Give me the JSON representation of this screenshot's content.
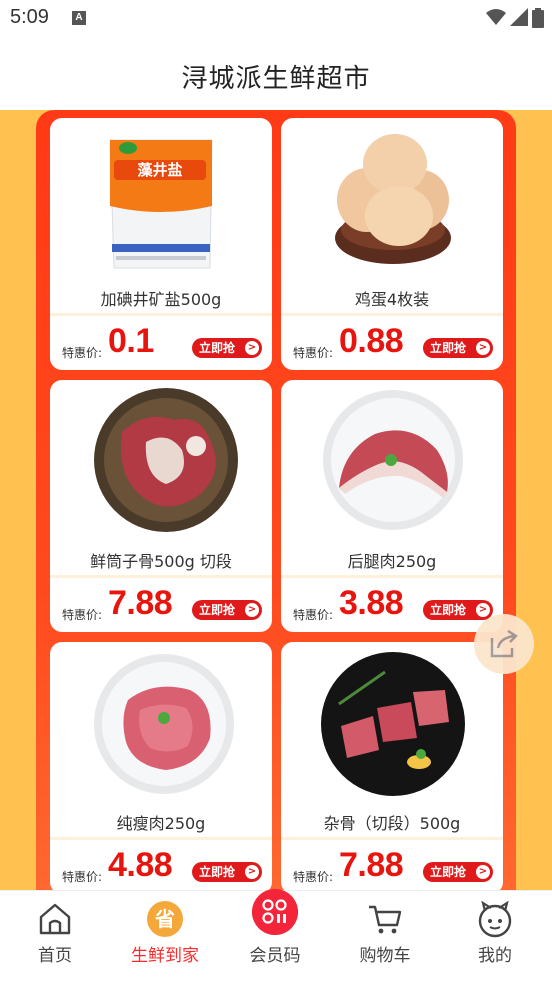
{
  "status_bar": {
    "time": "5:09",
    "notification_icon": "A"
  },
  "header": {
    "title": "浔城派生鲜超市"
  },
  "colors": {
    "accent": "#e8150e",
    "panel": "#ff3a16",
    "background": "#ffc14f",
    "active_tab": "#ff2a2a"
  },
  "products": [
    {
      "name": "加碘井矿盐500g",
      "price_label": "特惠价:",
      "price": "0.1",
      "button": "立即抢",
      "icon": "salt-bag-image",
      "package_text": "藻井盐"
    },
    {
      "name": "鸡蛋4枚装",
      "price_label": "特惠价:",
      "price": "0.88",
      "button": "立即抢",
      "icon": "eggs-image"
    },
    {
      "name": "鲜筒子骨500g 切段",
      "price_label": "特惠价:",
      "price": "7.88",
      "button": "立即抢",
      "icon": "pork-bone-image"
    },
    {
      "name": "后腿肉250g",
      "price_label": "特惠价:",
      "price": "3.88",
      "button": "立即抢",
      "icon": "pork-leg-image"
    },
    {
      "name": "纯瘦肉250g",
      "price_label": "特惠价:",
      "price": "4.88",
      "button": "立即抢",
      "icon": "lean-pork-image"
    },
    {
      "name": "杂骨（切段）500g",
      "price_label": "特惠价:",
      "price": "7.88",
      "button": "立即抢",
      "icon": "mixed-bone-image"
    }
  ],
  "tabs": [
    {
      "label": "首页",
      "icon": "home-icon",
      "active": false
    },
    {
      "label": "生鲜到家",
      "icon": "fresh-icon",
      "active": true,
      "icon_text": "省"
    },
    {
      "label": "会员码",
      "icon": "member-code-icon",
      "active": false
    },
    {
      "label": "购物车",
      "icon": "cart-icon",
      "active": false
    },
    {
      "label": "我的",
      "icon": "profile-icon",
      "active": false
    }
  ]
}
